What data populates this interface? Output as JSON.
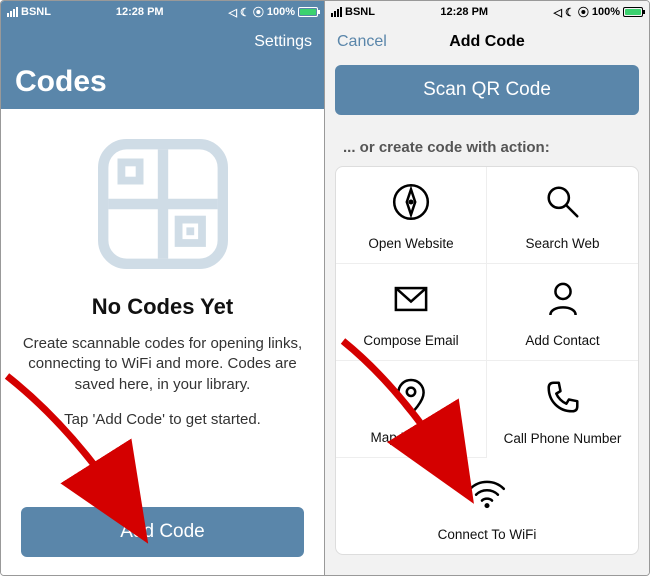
{
  "status": {
    "carrier": "BSNL",
    "time": "12:28 PM",
    "battery_pct": "100%"
  },
  "left": {
    "nav": {
      "title": "",
      "settings": "Settings"
    },
    "large_title": "Codes",
    "empty": {
      "title": "No Codes Yet",
      "desc": "Create scannable codes for opening links, connecting to WiFi and more. Codes are saved here, in your library.",
      "hint": "Tap 'Add Code' to get started."
    },
    "add_code_label": "Add Code"
  },
  "right": {
    "nav": {
      "cancel": "Cancel",
      "title": "Add Code"
    },
    "scan_label": "Scan QR Code",
    "or_label": "... or create code with action:",
    "actions": [
      {
        "label": "Open Website"
      },
      {
        "label": "Search Web"
      },
      {
        "label": "Compose Email"
      },
      {
        "label": "Add Contact"
      },
      {
        "label": "Map Location"
      },
      {
        "label": "Call Phone Number"
      },
      {
        "label": "Connect To WiFi"
      }
    ]
  },
  "colors": {
    "accent": "#5a86aa",
    "arrow": "#d40000"
  }
}
